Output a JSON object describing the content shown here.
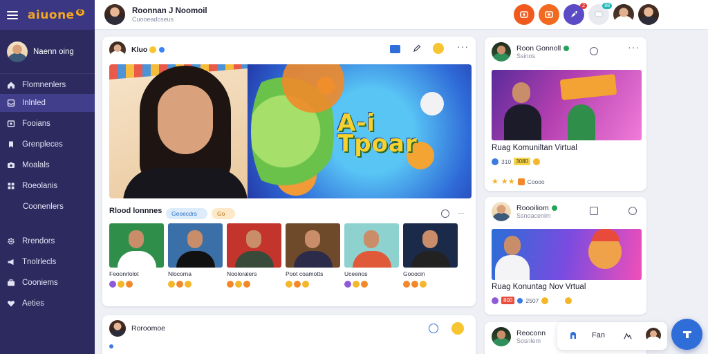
{
  "app": {
    "logo_text": "aiuone",
    "logo_badge": "6"
  },
  "sidebar": {
    "user_name": "Naenn oing",
    "items": [
      {
        "label": "Flomnenlers",
        "icon": "home-icon"
      },
      {
        "label": "Inlnled",
        "icon": "inbox-icon"
      },
      {
        "label": "Fooians",
        "icon": "media-icon"
      },
      {
        "label": "Grenpleces",
        "icon": "bookmark-icon"
      },
      {
        "label": "Moalals",
        "icon": "camera-icon"
      },
      {
        "label": "Roeolanis",
        "icon": "grid-icon"
      },
      {
        "label": "Coonenlers",
        "icon": "none"
      },
      {
        "label": "Rrendors",
        "icon": "gear-icon"
      },
      {
        "label": "Tnolrlecls",
        "icon": "megaphone-icon"
      },
      {
        "label": "Cooniems",
        "icon": "briefcase-icon"
      },
      {
        "label": "Aeties",
        "icon": "heart-icon"
      }
    ]
  },
  "topbar": {
    "profile_name": "Roonnan J Noomoil",
    "profile_sub": "Cuooeadcseus",
    "notification_badge": "2",
    "message_badge": "88"
  },
  "main_post": {
    "author": "Kluo",
    "hero_title": "A-i\nTpoar",
    "section_title": "Rlood lonnnes",
    "chip_1": "Geoecdrs",
    "chip_2": "Go",
    "thumbnails": [
      {
        "caption": "Feoonrlolot",
        "bg": "#2f8f4a",
        "shirt": "#ffffff"
      },
      {
        "caption": "Nlocorna",
        "bg": "#3a6fa8",
        "shirt": "#111111"
      },
      {
        "caption": "Nooloralers",
        "bg": "#c2342c",
        "shirt": "#3a4a3a"
      },
      {
        "caption": "Poot coamotts",
        "bg": "#6e4a2a",
        "shirt": "#2c2c4a"
      },
      {
        "caption": "Uceenos",
        "bg": "#8ed2d0",
        "shirt": "#e05a3a"
      },
      {
        "caption": "Gooocin",
        "bg": "#1a2a48",
        "shirt": "#222222"
      }
    ]
  },
  "second_post": {
    "author": "Roroomoe"
  },
  "side_posts": [
    {
      "author": "Roon Gonnoll",
      "sub": "Ssinos",
      "title": "Ruag Komuniltan Virtual",
      "count_1": "310",
      "count_2": "3080",
      "foot": "Coooo"
    },
    {
      "author": "Roooiliom",
      "sub": "Ssnoacenim",
      "title": "Ruag Konuntag Nov Vrtual",
      "count_1": "800",
      "count_2": "2507",
      "foot": ""
    },
    {
      "author": "Reoconn",
      "sub": "Sosnlem",
      "title": "",
      "count_1": "",
      "count_2": "",
      "foot": ""
    }
  ],
  "floatbar": {
    "label": "Fan"
  },
  "colors": {
    "sidebar_bg": "#2c2a5e",
    "accent_blue": "#2f6ed8",
    "accent_orange": "#f05a1e",
    "brand_yellow": "#f5a623"
  }
}
